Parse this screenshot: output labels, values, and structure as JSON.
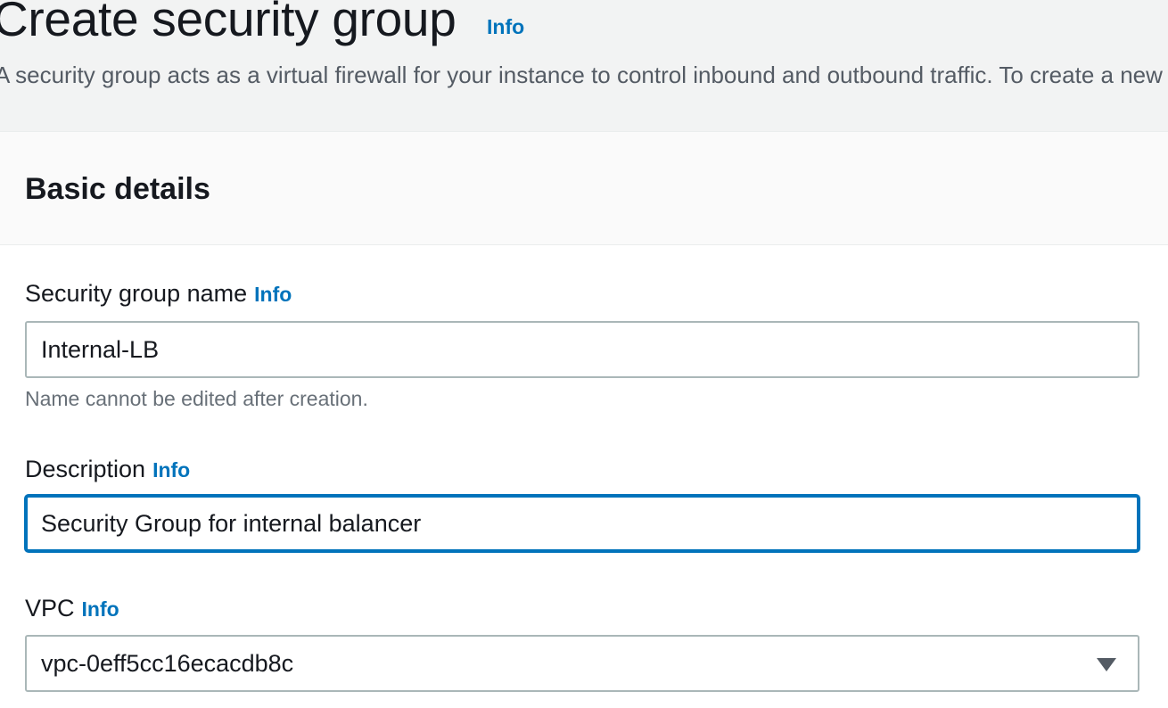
{
  "header": {
    "title": "Create security group",
    "info_label": "Info",
    "description": "A security group acts as a virtual firewall for your instance to control inbound and outbound traffic. To create a new security group, complete the fields below."
  },
  "basic_details": {
    "title": "Basic details",
    "name_field": {
      "label": "Security group name",
      "info_label": "Info",
      "value": "Internal-LB",
      "hint": "Name cannot be edited after creation."
    },
    "description_field": {
      "label": "Description",
      "info_label": "Info",
      "value": "Security Group for internal balancer"
    },
    "vpc_field": {
      "label": "VPC",
      "info_label": "Info",
      "selected": "vpc-0eff5cc16ecacdb8c"
    }
  },
  "colors": {
    "link": "#0073bb",
    "focus_border": "#0073bb",
    "header_bg": "#f2f3f3",
    "input_border": "#aab7b8"
  }
}
